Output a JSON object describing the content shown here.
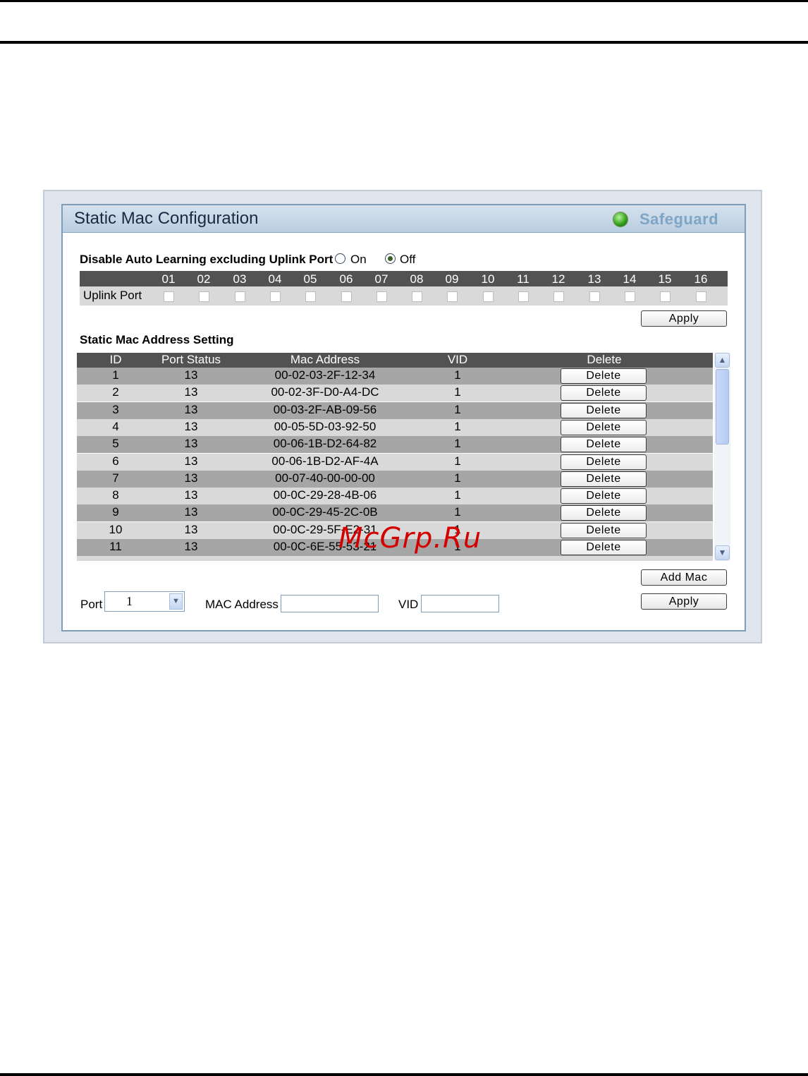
{
  "panel": {
    "title": "Static Mac Configuration",
    "safeguard_label": "Safeguard"
  },
  "auto_learning": {
    "label": "Disable Auto Learning excluding Uplink Port",
    "on_label": "On",
    "off_label": "Off",
    "selected": "Off"
  },
  "uplink": {
    "row_label": "Uplink Port",
    "ports": [
      "01",
      "02",
      "03",
      "04",
      "05",
      "06",
      "07",
      "08",
      "09",
      "10",
      "11",
      "12",
      "13",
      "14",
      "15",
      "16"
    ],
    "apply_label": "Apply"
  },
  "static_mac": {
    "section_title": "Static Mac Address Setting",
    "columns": [
      "ID",
      "Port Status",
      "Mac Address",
      "VID",
      "Delete"
    ],
    "rows": [
      {
        "id": "1",
        "port": "13",
        "mac": "00-02-03-2F-12-34",
        "vid": "1",
        "action": "Delete"
      },
      {
        "id": "2",
        "port": "13",
        "mac": "00-02-3F-D0-A4-DC",
        "vid": "1",
        "action": "Delete"
      },
      {
        "id": "3",
        "port": "13",
        "mac": "00-03-2F-AB-09-56",
        "vid": "1",
        "action": "Delete"
      },
      {
        "id": "4",
        "port": "13",
        "mac": "00-05-5D-03-92-50",
        "vid": "1",
        "action": "Delete"
      },
      {
        "id": "5",
        "port": "13",
        "mac": "00-06-1B-D2-64-82",
        "vid": "1",
        "action": "Delete"
      },
      {
        "id": "6",
        "port": "13",
        "mac": "00-06-1B-D2-AF-4A",
        "vid": "1",
        "action": "Delete"
      },
      {
        "id": "7",
        "port": "13",
        "mac": "00-07-40-00-00-00",
        "vid": "1",
        "action": "Delete"
      },
      {
        "id": "8",
        "port": "13",
        "mac": "00-0C-29-28-4B-06",
        "vid": "1",
        "action": "Delete"
      },
      {
        "id": "9",
        "port": "13",
        "mac": "00-0C-29-45-2C-0B",
        "vid": "1",
        "action": "Delete"
      },
      {
        "id": "10",
        "port": "13",
        "mac": "00-0C-29-5F-E2-31",
        "vid": "1",
        "action": "Delete"
      },
      {
        "id": "11",
        "port": "13",
        "mac": "00-0C-6E-55-53-21",
        "vid": "1",
        "action": "Delete"
      }
    ],
    "add_mac_label": "Add Mac",
    "apply_label": "Apply"
  },
  "form": {
    "port_label": "Port",
    "port_value": "1",
    "mac_label": "MAC Address",
    "mac_value": "",
    "vid_label": "VID",
    "vid_value": ""
  },
  "watermark": "McGrp.Ru",
  "colors": {
    "header_bg": "#525252",
    "row_dark": "#a6a6a6",
    "row_light": "#d9d9d9",
    "panel_border": "#7f9db9",
    "watermark": "#d40000"
  }
}
